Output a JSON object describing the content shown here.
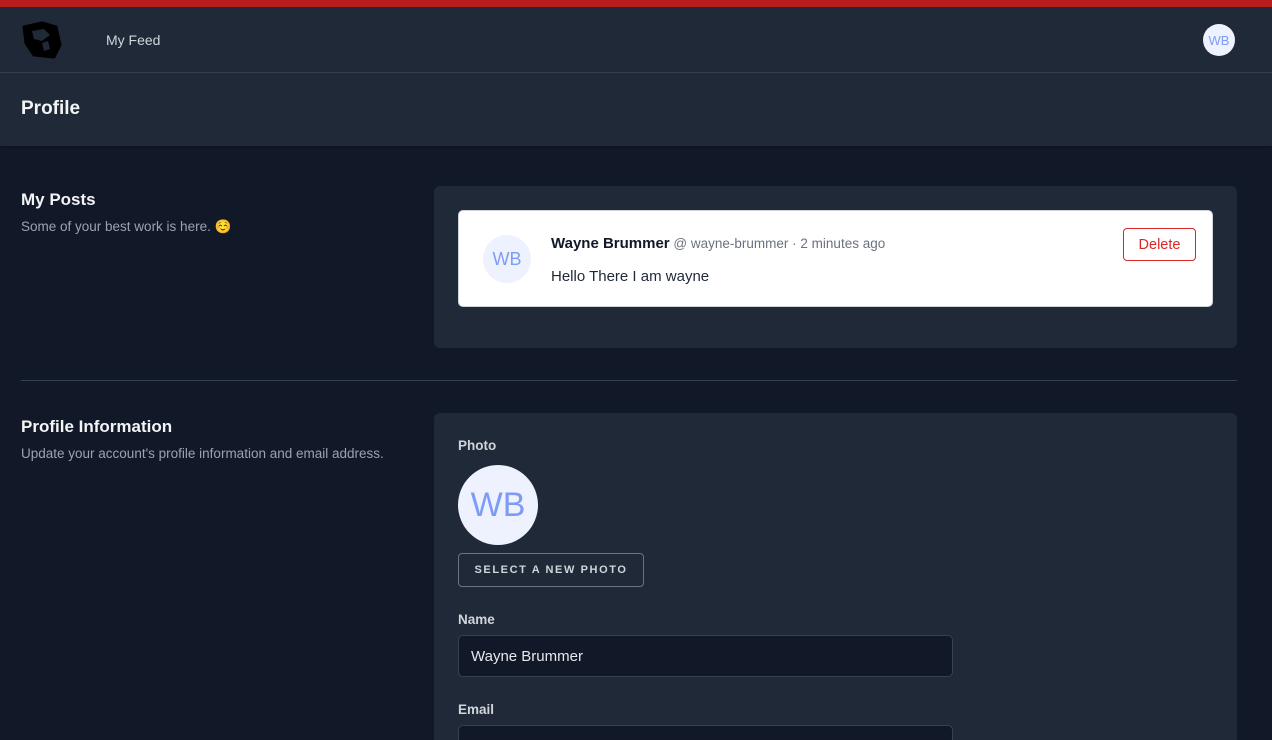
{
  "nav": {
    "feed_link": "My Feed",
    "avatar_initials": "WB"
  },
  "header": {
    "title": "Profile"
  },
  "posts_section": {
    "title": "My Posts",
    "description": "Some of your best work is here. ☺️"
  },
  "post": {
    "avatar_initials": "WB",
    "author": "Wayne Brummer",
    "handle": "@ wayne-brummer",
    "time": "· 2 minutes ago",
    "body": "Hello There I am wayne",
    "delete_label": "Delete"
  },
  "profile_section": {
    "title": "Profile Information",
    "description": "Update your account's profile information and email address.",
    "photo_label": "Photo",
    "photo_initials": "WB",
    "select_photo_label": "SELECT A NEW PHOTO",
    "name_label": "Name",
    "name_value": "Wayne Brummer",
    "email_label": "Email",
    "email_value": ""
  },
  "colors": {
    "accent_red": "#b91c1c",
    "background": "#111827",
    "panel": "#1f2937",
    "avatar_text": "#7f9cf5",
    "delete": "#dc2626"
  }
}
